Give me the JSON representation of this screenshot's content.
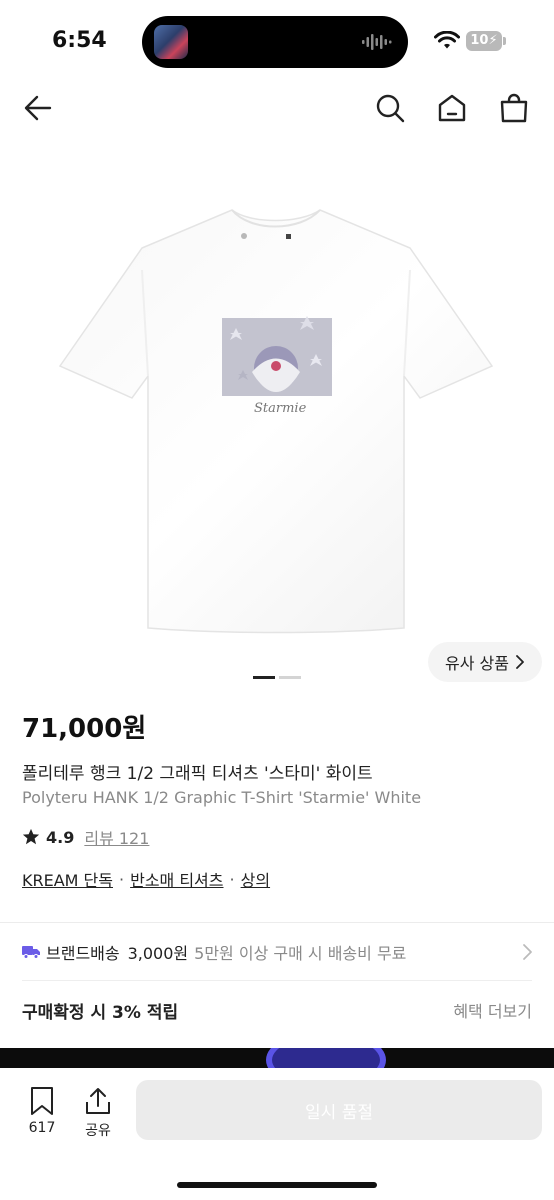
{
  "status": {
    "time": "6:54",
    "battery": "10"
  },
  "product": {
    "price": "71,000원",
    "title_ko": "폴리테루 행크 1/2 그래픽 티셔츠 '스타미' 화이트",
    "title_en": "Polyteru HANK 1/2 Graphic T-Shirt 'Starmie' White",
    "rating": "4.9",
    "review_link": "리뷰 121",
    "similar_button": "유사 상품",
    "print_text": "Starmie"
  },
  "categories": [
    {
      "label": "KREAM 단독"
    },
    {
      "label": "반소매 티셔츠"
    },
    {
      "label": "상의"
    }
  ],
  "category_separator": "·",
  "shipping": {
    "label": "브랜드배송",
    "fee": "3,000원",
    "note": "5만원 이상 구매 시 배송비 무료"
  },
  "points": {
    "label": "구매확정 시 3% 적립",
    "benefits_link": "혜택 더보기"
  },
  "bottom_bar": {
    "bookmark_count": "617",
    "share_label": "공유",
    "buy_button": "일시 품절"
  },
  "icons": {
    "back": "arrow-left-icon",
    "search": "search-icon",
    "home": "home-icon",
    "bag": "shopping-bag-icon",
    "star": "star-icon",
    "truck": "truck-icon",
    "chevron": "chevron-right-icon",
    "bookmark": "bookmark-icon",
    "share": "share-icon"
  },
  "colors": {
    "text": "#222222",
    "muted": "#8a8a8a",
    "shipping_icon": "#6b5ce7",
    "disabled_button": "#ebebeb"
  }
}
